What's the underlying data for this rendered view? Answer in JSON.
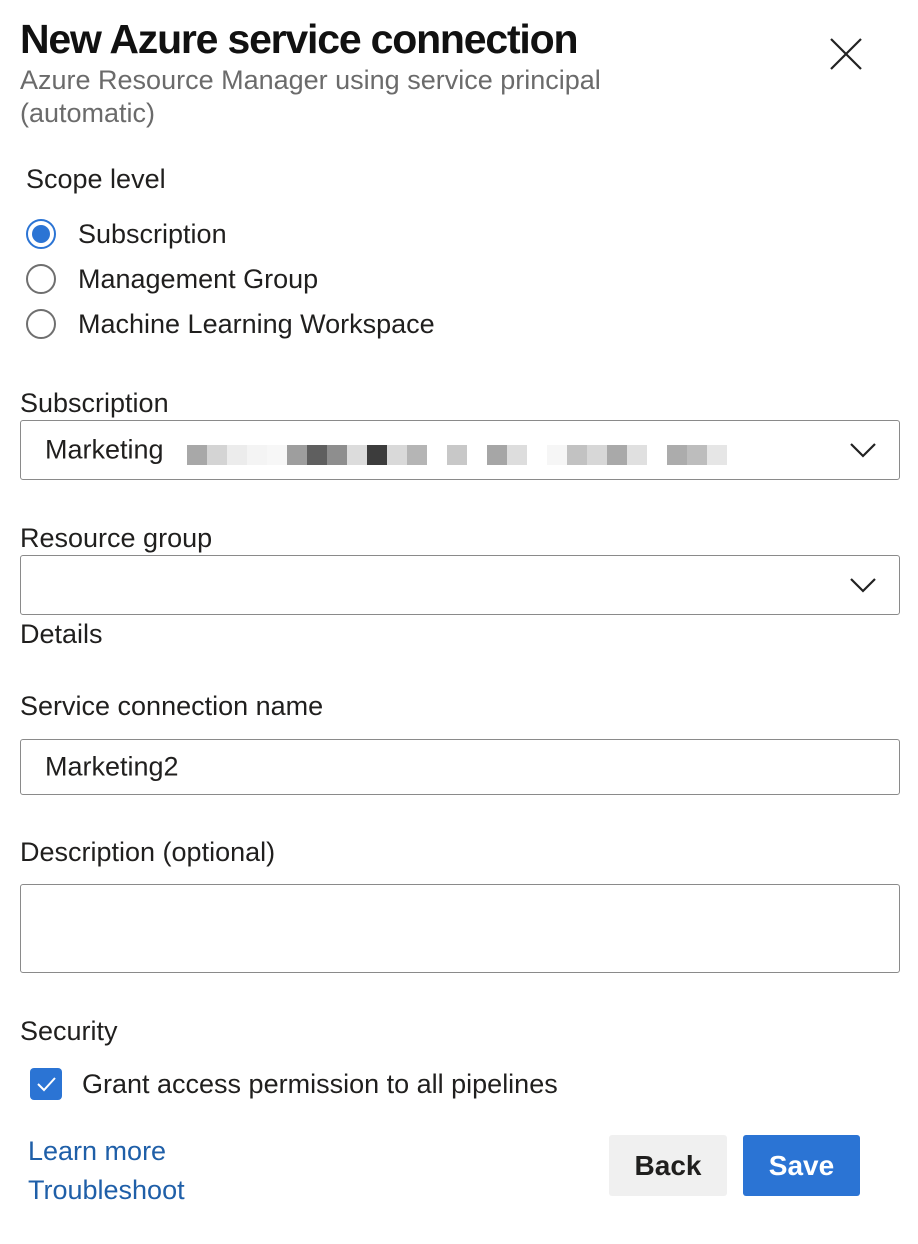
{
  "header": {
    "title": "New Azure service connection",
    "subtitle": "Azure Resource Manager using service principal (automatic)",
    "close_icon": "close-icon"
  },
  "scope": {
    "label": "Scope level",
    "options": [
      {
        "label": "Subscription",
        "checked": true
      },
      {
        "label": "Management Group",
        "checked": false
      },
      {
        "label": "Machine Learning Workspace",
        "checked": false
      }
    ]
  },
  "subscription": {
    "label": "Subscription",
    "value": "Marketing",
    "redacted": true
  },
  "resource_group": {
    "label": "Resource group",
    "value": ""
  },
  "details": {
    "label": "Details"
  },
  "connection_name": {
    "label": "Service connection name",
    "value": "Marketing2"
  },
  "description": {
    "label": "Description (optional)",
    "value": ""
  },
  "security": {
    "label": "Security",
    "grant_access_label": "Grant access permission to all pipelines",
    "grant_access_checked": true
  },
  "links": {
    "learn_more": "Learn more",
    "troubleshoot": "Troubleshoot"
  },
  "buttons": {
    "back": "Back",
    "save": "Save"
  },
  "colors": {
    "accent": "#2b74d4",
    "link": "#1f5fa8"
  }
}
